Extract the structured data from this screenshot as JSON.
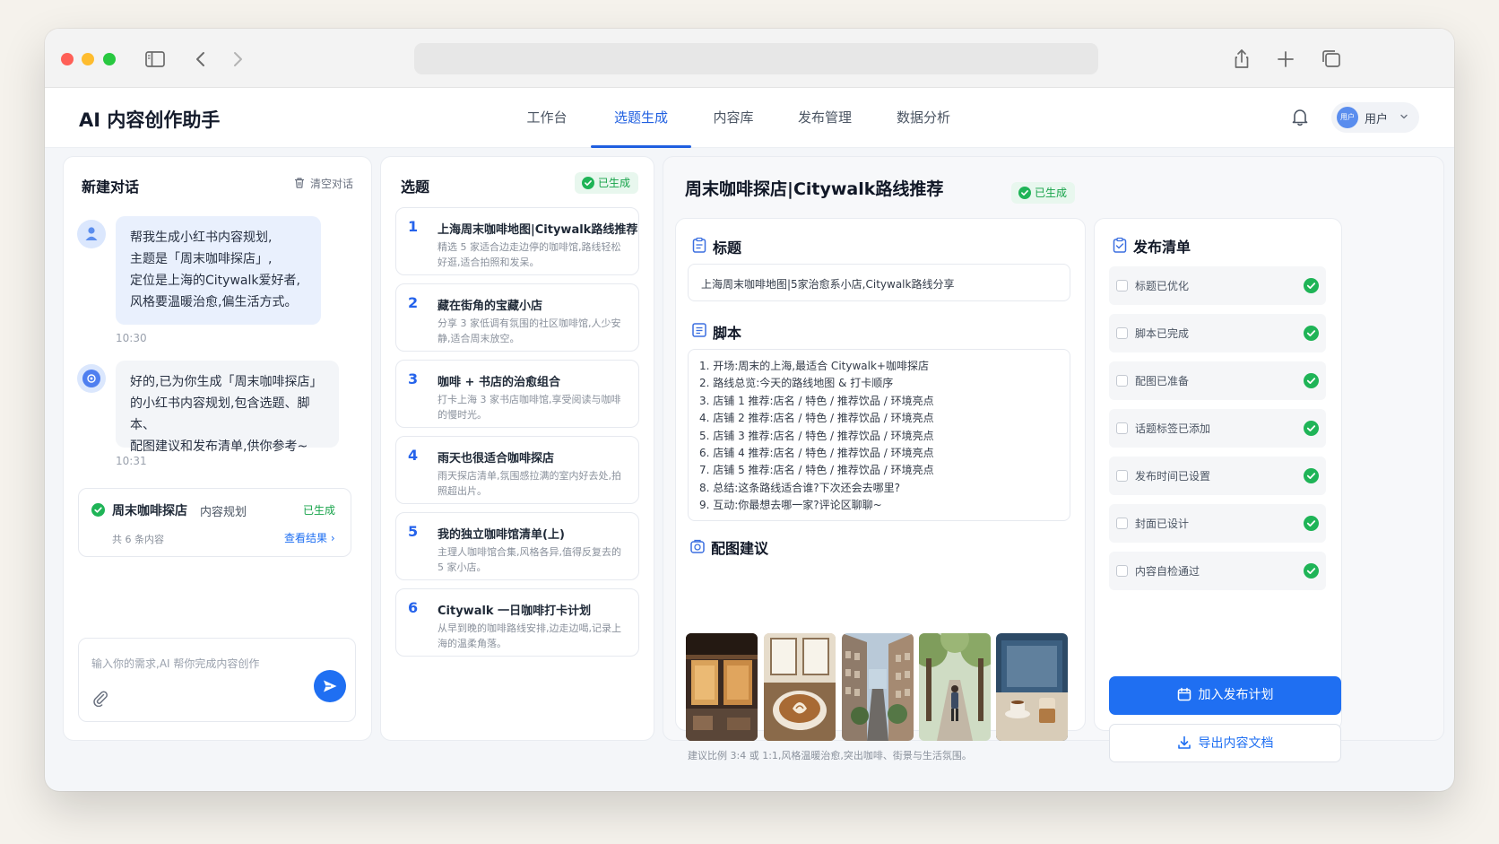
{
  "app": {
    "title": "AI 内容创作助手",
    "user": "用户",
    "avatar_text": "用户"
  },
  "nav": {
    "tabs": [
      "工作台",
      "选题生成",
      "内容库",
      "发布管理",
      "数据分析"
    ],
    "active": "选题生成"
  },
  "colors": {
    "accent": "#1f6ff2",
    "success": "#17a34a",
    "success_bg": "#e8f7ee"
  },
  "chat": {
    "title": "新建对话",
    "clear_label": "清空对话",
    "user_message": [
      "帮我生成小红书内容规划,",
      "主题是「周末咖啡探店」,",
      "定位是上海的Citywalk爱好者,",
      "风格要温暖治愈,偏生活方式。"
    ],
    "user_time": "10:30",
    "ai_message": [
      "好的,已为你生成「周末咖啡探店」",
      "的小红书内容规划,包含选题、脚本、",
      "配图建议和发布清单,供你参考~"
    ],
    "ai_time": "10:31",
    "plan_card": {
      "name": "周末咖啡探店",
      "suffix": "内容规划",
      "status": "已生成",
      "count": "共 6 条内容",
      "link": "查看结果 ›"
    },
    "input_placeholder": "输入你的需求,AI 帮你完成内容创作"
  },
  "topics": {
    "title": "选题",
    "status": "已生成",
    "items": [
      {
        "num": "1",
        "title": "上海周末咖啡地图|Citywalk路线推荐",
        "desc": "精选 5 家适合边走边停的咖啡馆,路线轻松好逛,适合拍照和发呆。"
      },
      {
        "num": "2",
        "title": "藏在街角的宝藏小店",
        "desc": "分享 3 家低调有氛围的社区咖啡馆,人少安静,适合周末放空。"
      },
      {
        "num": "3",
        "title": "咖啡 + 书店的治愈组合",
        "desc": "打卡上海 3 家书店咖啡馆,享受阅读与咖啡的慢时光。"
      },
      {
        "num": "4",
        "title": "雨天也很适合咖啡探店",
        "desc": "雨天探店清单,氛围感拉满的室内好去处,拍照超出片。"
      },
      {
        "num": "5",
        "title": "我的独立咖啡馆清单(上)",
        "desc": "主理人咖啡馆合集,风格各异,值得反复去的 5 家小店。"
      },
      {
        "num": "6",
        "title": "Citywalk 一日咖啡打卡计划",
        "desc": "从早到晚的咖啡路线安排,边走边喝,记录上海的温柔角落。"
      }
    ]
  },
  "detail": {
    "title": "周末咖啡探店|Citywalk路线推荐",
    "status": "已生成",
    "title_section": {
      "label": "标题",
      "value": "上海周末咖啡地图|5家治愈系小店,Citywalk路线分享"
    },
    "script_section": {
      "label": "脚本",
      "lines": [
        "1. 开场:周末的上海,最适合 Citywalk+咖啡探店",
        "2. 路线总览:今天的路线地图 & 打卡顺序",
        "3. 店铺 1 推荐:店名 / 特色 / 推荐饮品 / 环境亮点",
        "4. 店铺 2 推荐:店名 / 特色 / 推荐饮品 / 环境亮点",
        "5. 店铺 3 推荐:店名 / 特色 / 推荐饮品 / 环境亮点",
        "6. 店铺 4 推荐:店名 / 特色 / 推荐饮品 / 环境亮点",
        "7. 店铺 5 推荐:店名 / 特色 / 推荐饮品 / 环境亮点",
        "8. 总结:这条路线适合谁?下次还会去哪里?",
        "9. 互动:你最想去哪一家?评论区聊聊~"
      ]
    },
    "images_section": {
      "label": "配图建议",
      "note": "建议比例 3:4 或 1:1,风格温暖治愈,突出咖啡、街景与生活氛围。"
    }
  },
  "checklist": {
    "title": "发布清单",
    "items": [
      "标题已优化",
      "脚本已完成",
      "配图已准备",
      "话题标签已添加",
      "发布时间已设置",
      "封面已设计",
      "内容自检通过"
    ],
    "primary_button": "加入发布计划",
    "secondary_button": "导出内容文档"
  }
}
